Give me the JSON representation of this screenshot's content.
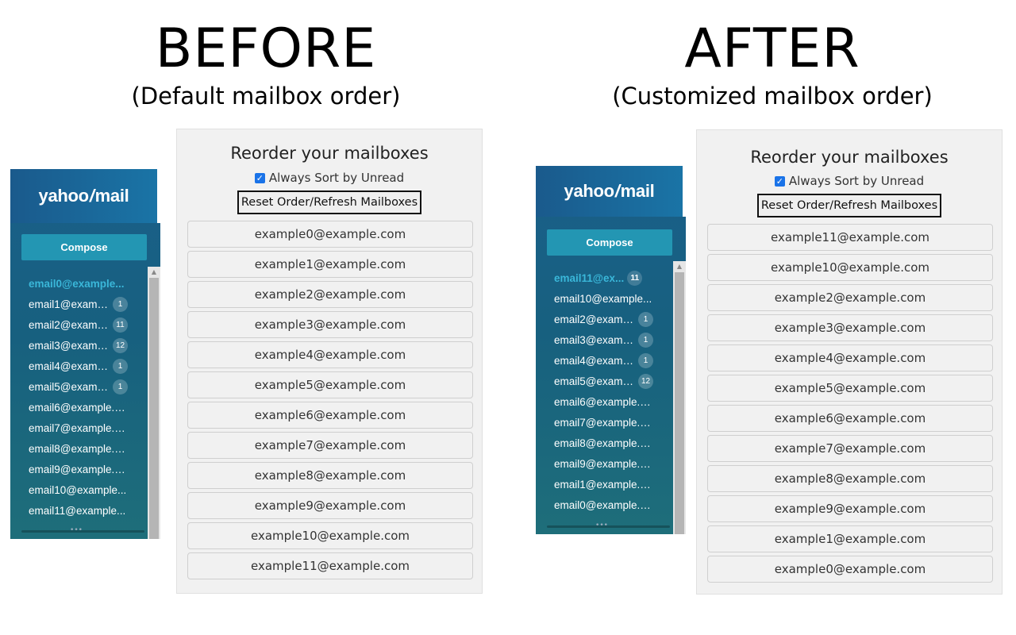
{
  "before": {
    "title": "BEFORE",
    "subtitle": "(Default mailbox order)",
    "sidebar": {
      "logo_text_left": "yahoo",
      "logo_slash": "/",
      "logo_text_right": "mail",
      "compose_label": "Compose",
      "items": [
        {
          "label": "email0@example...",
          "badge": "",
          "active": true
        },
        {
          "label": "email1@example.com",
          "badge": "1"
        },
        {
          "label": "email2@example.com",
          "badge": "11"
        },
        {
          "label": "email3@example.com",
          "badge": "12"
        },
        {
          "label": "email4@example.com",
          "badge": "1"
        },
        {
          "label": "email5@example.com",
          "badge": "1"
        },
        {
          "label": "email6@example.c...",
          "badge": ""
        },
        {
          "label": "email7@example.c...",
          "badge": ""
        },
        {
          "label": "email8@example.c...",
          "badge": ""
        },
        {
          "label": "email9@example.c...",
          "badge": ""
        },
        {
          "label": "email10@example...",
          "badge": ""
        },
        {
          "label": "email11@example...",
          "badge": ""
        }
      ]
    },
    "panel": {
      "title": "Reorder your mailboxes",
      "sort_label": "Always Sort by Unread",
      "sort_checked": true,
      "reset_label": "Reset Order/Refresh Mailboxes",
      "mailboxes": [
        "example0@example.com",
        "example1@example.com",
        "example2@example.com",
        "example3@example.com",
        "example4@example.com",
        "example5@example.com",
        "example6@example.com",
        "example7@example.com",
        "example8@example.com",
        "example9@example.com",
        "example10@example.com",
        "example11@example.com"
      ]
    }
  },
  "after": {
    "title": "AFTER",
    "subtitle": "(Customized mailbox order)",
    "sidebar": {
      "logo_text_left": "yahoo",
      "logo_slash": "/",
      "logo_text_right": "mail",
      "compose_label": "Compose",
      "items": [
        {
          "label": "email11@ex...",
          "badge": "11",
          "active": true
        },
        {
          "label": "email10@example...",
          "badge": ""
        },
        {
          "label": "email2@example.com",
          "badge": "1"
        },
        {
          "label": "email3@example.com",
          "badge": "1"
        },
        {
          "label": "email4@example.com",
          "badge": "1"
        },
        {
          "label": "email5@example.com",
          "badge": "12"
        },
        {
          "label": "email6@example.c...",
          "badge": ""
        },
        {
          "label": "email7@example.c...",
          "badge": ""
        },
        {
          "label": "email8@example.c...",
          "badge": ""
        },
        {
          "label": "email9@example.c...",
          "badge": ""
        },
        {
          "label": "email1@example.c...",
          "badge": ""
        },
        {
          "label": "email0@example.c...",
          "badge": ""
        }
      ]
    },
    "panel": {
      "title": "Reorder your mailboxes",
      "sort_label": "Always Sort by Unread",
      "sort_checked": true,
      "reset_label": "Reset Order/Refresh Mailboxes",
      "mailboxes": [
        "example11@example.com",
        "example10@example.com",
        "example2@example.com",
        "example3@example.com",
        "example4@example.com",
        "example5@example.com",
        "example6@example.com",
        "example7@example.com",
        "example8@example.com",
        "example9@example.com",
        "example1@example.com",
        "example0@example.com"
      ]
    }
  },
  "colors": {
    "sidebar_top": "#1a5f8a",
    "sidebar_bottom": "#1e6e7a",
    "compose_bg": "#2396b3",
    "active_item": "#3ab7d9",
    "panel_bg": "#f1f1f1",
    "checkbox": "#1a73e8"
  }
}
